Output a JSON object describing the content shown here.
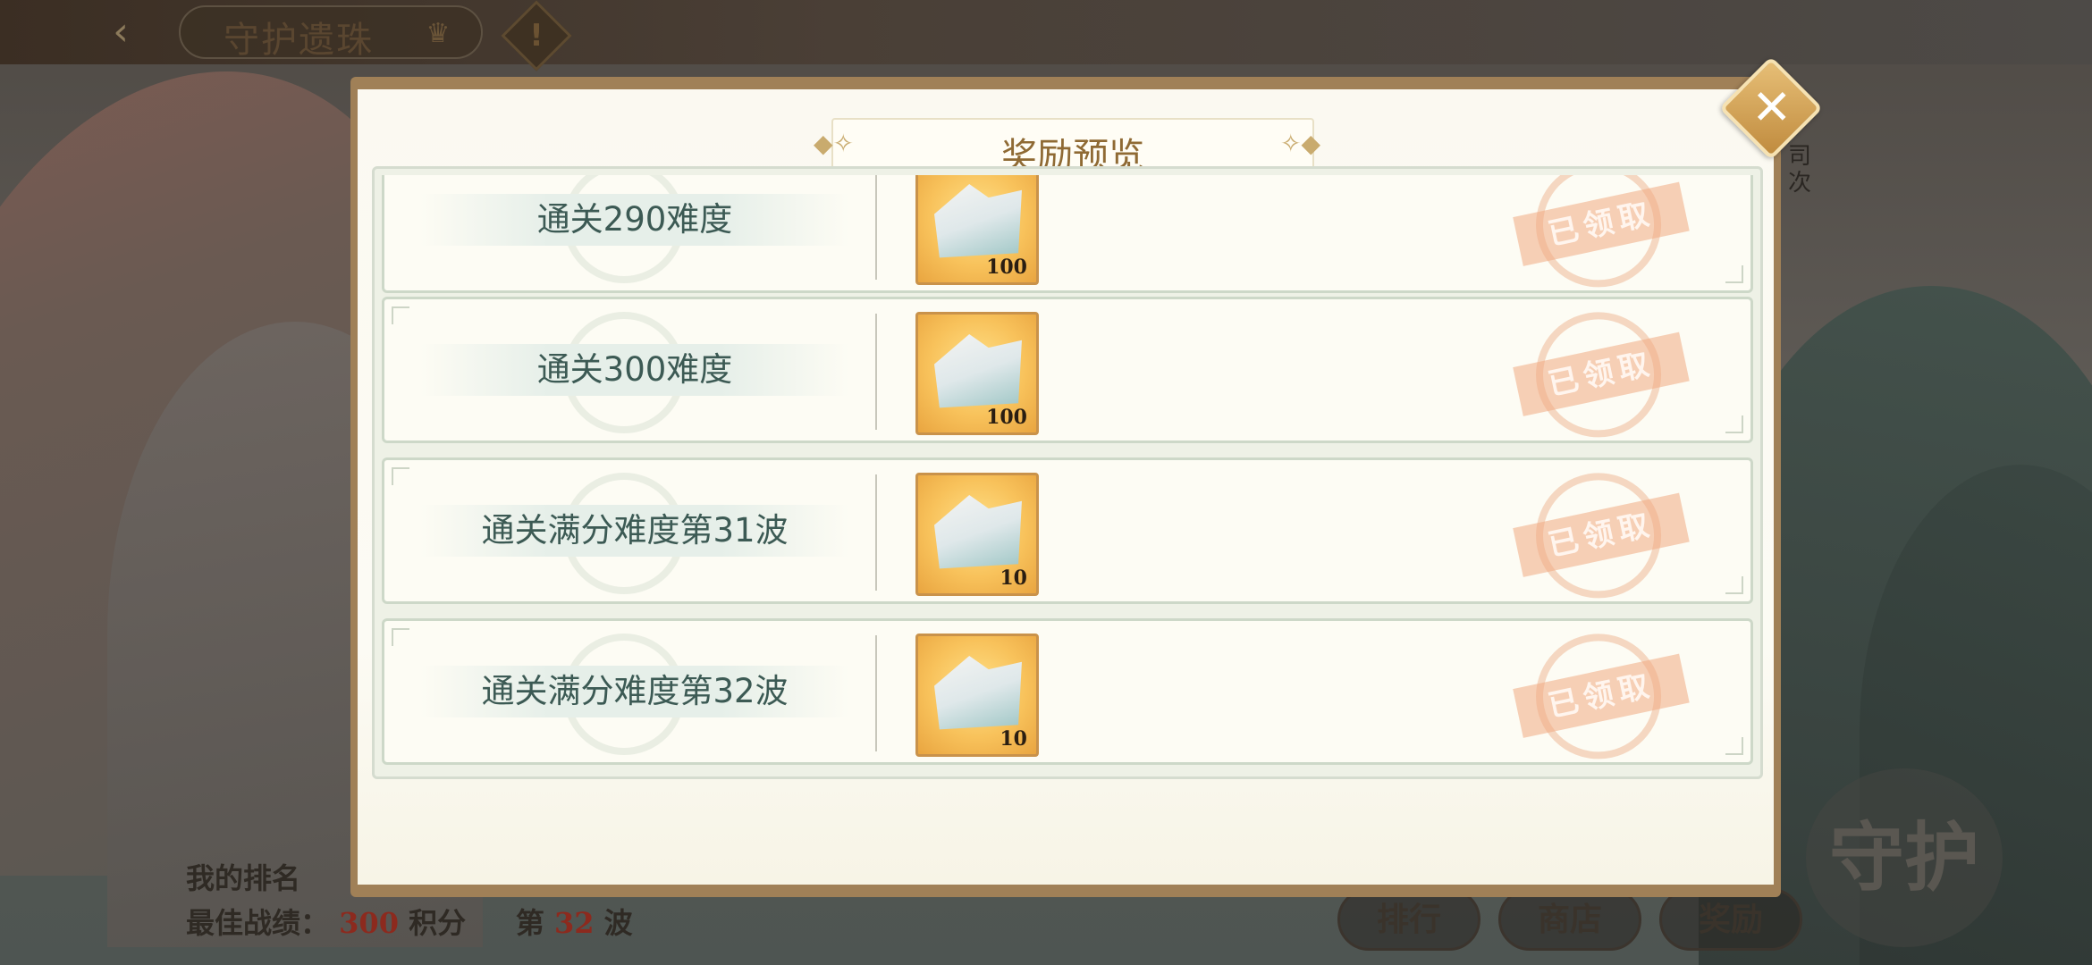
{
  "header": {
    "back_icon": "back-arrow-icon",
    "title": "守护遗珠",
    "rank_icon": "crown-icon",
    "info_label": "!"
  },
  "side_note": "司\n次",
  "bottom": {
    "my_rank_label": "我的排名",
    "best_label": "最佳战绩：",
    "best_score": "300",
    "score_unit": "积分",
    "wave_prefix": "第",
    "wave_value": "32",
    "wave_suffix": "波",
    "buttons": [
      "排行",
      "商店",
      "奖励"
    ],
    "emblem_text": "守护"
  },
  "modal": {
    "title": "奖励预览",
    "close_label": "✕",
    "rows": [
      {
        "label": "通关290难度",
        "item_qty": "100",
        "status": "已领取"
      },
      {
        "label": "通关300难度",
        "item_qty": "100",
        "status": "已领取"
      },
      {
        "label": "通关满分难度第31波",
        "item_qty": "10",
        "status": "已领取"
      },
      {
        "label": "通关满分难度第32波",
        "item_qty": "10",
        "status": "已领取"
      }
    ]
  }
}
